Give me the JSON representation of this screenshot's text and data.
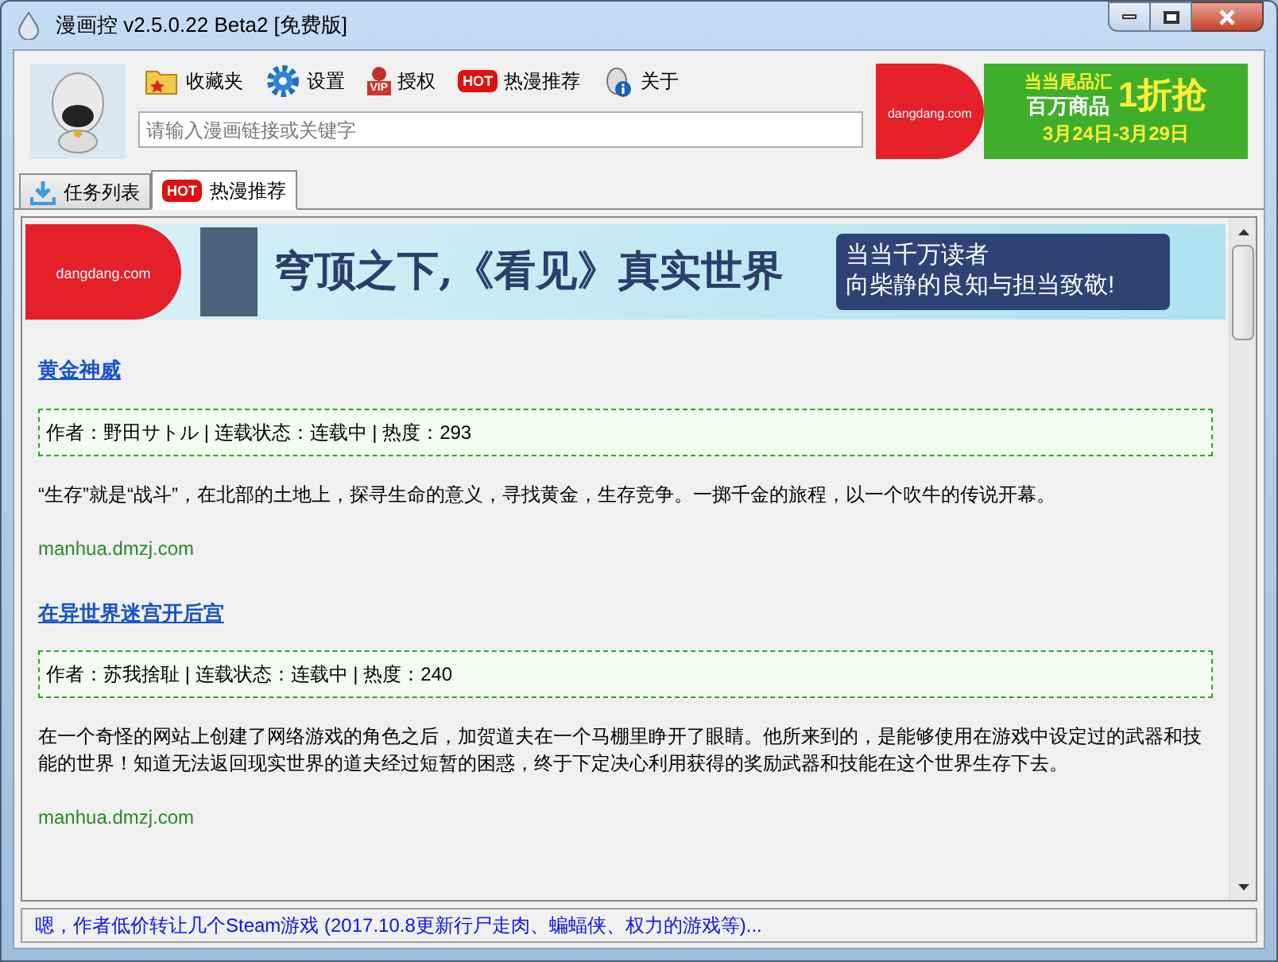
{
  "window": {
    "title": "漫画控 v2.5.0.22 Beta2 [免费版]"
  },
  "toolbar": [
    {
      "kind": "folder",
      "label": "收藏夹"
    },
    {
      "kind": "gear",
      "label": "设置"
    },
    {
      "kind": "vip",
      "label": "授权",
      "badge": "VIP"
    },
    {
      "kind": "hot",
      "label": "热漫推荐",
      "badge": "HOT"
    },
    {
      "kind": "info",
      "label": "关于"
    }
  ],
  "search": {
    "placeholder": "请输入漫画链接或关键字"
  },
  "top_ad": {
    "brand": "dangdang.com",
    "line_1": "当当尾品汇",
    "line_2": "百万商品",
    "big": "1折抢",
    "dates": "3月24日-3月29日"
  },
  "tabs": [
    {
      "label": "任务列表",
      "kind": "download",
      "selected": false
    },
    {
      "label": "热漫推荐",
      "kind": "hot",
      "badge": "HOT",
      "selected": true
    }
  ],
  "banner": {
    "brand": "dangdang.com",
    "headline": "穹顶之下,《看见》真实世界",
    "line_1": "当当千万读者",
    "line_2": "向柴静的良知与担当致敬!"
  },
  "items": [
    {
      "title": "黄金神威",
      "info": "作者：野田サトル | 连载状态：连载中 | 热度：293",
      "description": "“生存”就是“战斗”，在北部的土地上，探寻生命的意义，寻找黄金，生存竞争。一掷千金的旅程，以一个吹牛的传说开幕。",
      "source": "manhua.dmzj.com"
    },
    {
      "title": "在异世界迷宫开后宫",
      "info": "作者：苏我捨耻 | 连载状态：连载中 | 热度：240",
      "description": "在一个奇怪的网站上创建了网络游戏的角色之后，加贺道夫在一个马棚里睁开了眼睛。他所来到的，是能够使用在游戏中设定过的武器和技能的世界！知道无法返回现实世界的道夫经过短暂的困惑，终于下定决心利用获得的奖励武器和技能在这个世界生存下去。",
      "source": "manhua.dmzj.com"
    }
  ],
  "status_bar": {
    "text": "嗯，作者低价转让几个Steam游戏 (2017.10.8更新行尸走肉、蝙蝠侠、权力的游戏等)..."
  }
}
